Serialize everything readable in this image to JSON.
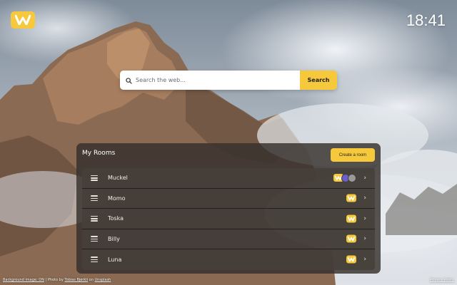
{
  "app": {
    "clock": "18:41"
  },
  "search": {
    "placeholder": "Search the web...",
    "button_label": "Search"
  },
  "rooms_panel": {
    "title": "My Rooms",
    "create_label": "Create a room",
    "rooms": [
      {
        "name": "Muckel",
        "members": [
          "logo",
          "avatar-purple",
          "avatar-gray"
        ]
      },
      {
        "name": "Momo",
        "members": [
          "logo"
        ]
      },
      {
        "name": "Toska",
        "members": [
          "logo"
        ]
      },
      {
        "name": "Billy",
        "members": [
          "logo"
        ]
      },
      {
        "name": "Luna",
        "members": [
          "logo"
        ]
      }
    ]
  },
  "footer": {
    "bg_link": "Background image: ON",
    "separator": " | Photo by ",
    "photographer": "Tobias Bjørkli",
    "on": " on ",
    "source": "Unsplash",
    "privacy": "Privacy Policy"
  },
  "icons": {
    "logo": "logo-icon",
    "search": "search-icon",
    "handle": "drag-handle-icon",
    "chevron": "chevron-right-icon"
  },
  "colors": {
    "accent": "#f6c83b",
    "panel": "#34302c",
    "avatar_purple": "#6b5fc9",
    "avatar_gray": "#9a9a9a"
  }
}
